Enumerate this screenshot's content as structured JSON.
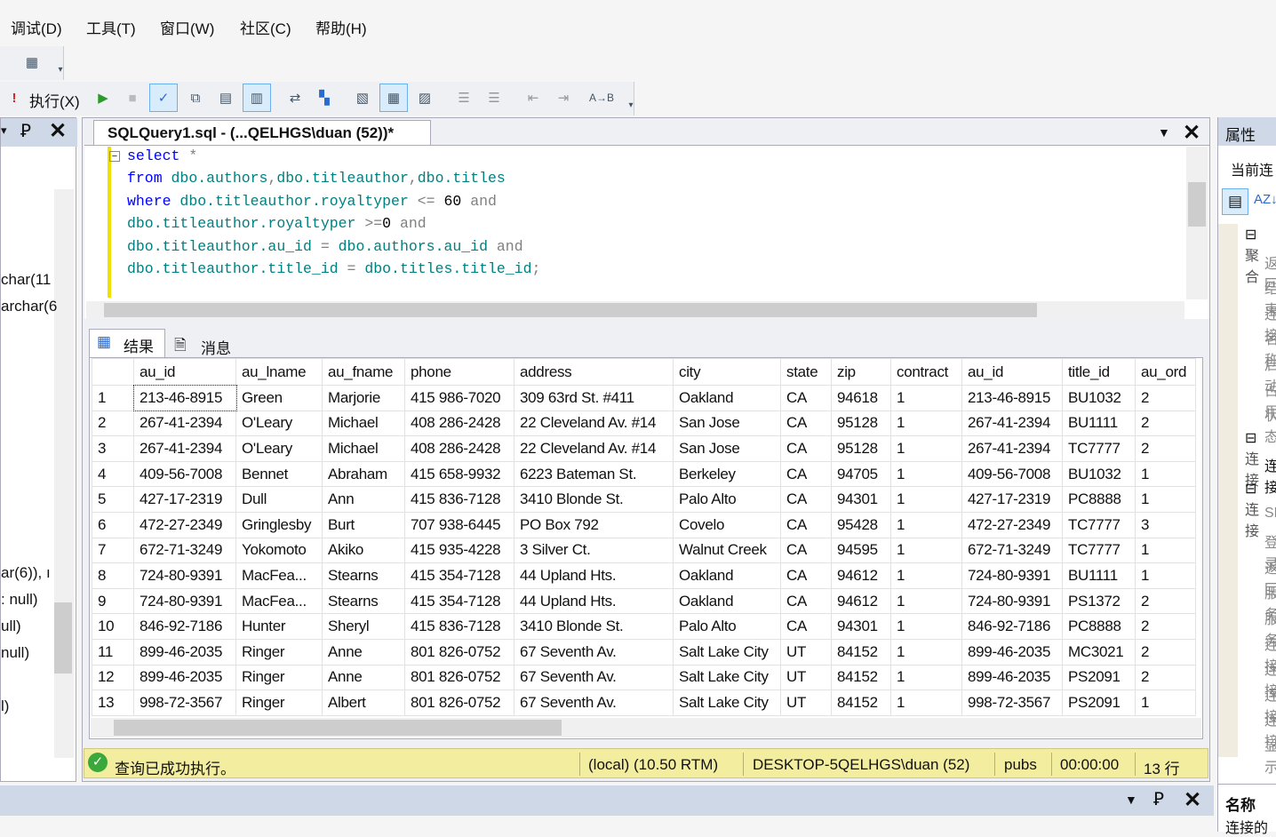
{
  "menu": [
    "调试(D)",
    "工具(T)",
    "窗口(W)",
    "社区(C)",
    "帮助(H)"
  ],
  "toolbar": {
    "execute_label": "执行(X)"
  },
  "left_panel": {
    "lines": [
      "char(11",
      "archar(6",
      "ar(6)), ı",
      ": null)",
      "ull)",
      "null)",
      "l)"
    ]
  },
  "editor": {
    "tab_title": "SQLQuery1.sql - (...QELHGS\\duan (52))*",
    "lines": [
      [
        [
          "kw",
          "select"
        ],
        [
          "op",
          " *"
        ]
      ],
      [
        [
          "kw",
          "from"
        ],
        [
          "id",
          " dbo.authors"
        ],
        [
          "op",
          ","
        ],
        [
          "id",
          "dbo.titleauthor"
        ],
        [
          "op",
          ","
        ],
        [
          "id",
          "dbo.titles"
        ]
      ],
      [
        [
          "kw",
          "where"
        ],
        [
          "id",
          " dbo.titleauthor.royaltyper"
        ],
        [
          "op",
          " <="
        ],
        [
          "nm",
          " 60"
        ],
        [
          "op",
          " and"
        ]
      ],
      [
        [
          "id",
          "dbo.titleauthor.royaltyper"
        ],
        [
          "op",
          " >="
        ],
        [
          "nm",
          "0"
        ],
        [
          "op",
          " and"
        ]
      ],
      [
        [
          "id",
          "dbo.titleauthor.au_id"
        ],
        [
          "op",
          " ="
        ],
        [
          "id",
          " dbo.authors.au_id"
        ],
        [
          "op",
          " and"
        ]
      ],
      [
        [
          "id",
          "dbo.titleauthor.title_id"
        ],
        [
          "op",
          " ="
        ],
        [
          "id",
          " dbo.titles.title_id"
        ],
        [
          "op",
          ";"
        ]
      ]
    ]
  },
  "results": {
    "tabs": [
      "结果",
      "消息"
    ],
    "columns": [
      "",
      "au_id",
      "au_lname",
      "au_fname",
      "phone",
      "address",
      "city",
      "state",
      "zip",
      "contract",
      "au_id",
      "title_id",
      "au_ord"
    ],
    "rows": [
      [
        "1",
        "213-46-8915",
        "Green",
        "Marjorie",
        "415 986-7020",
        "309 63rd St. #411",
        "Oakland",
        "CA",
        "94618",
        "1",
        "213-46-8915",
        "BU1032",
        "2"
      ],
      [
        "2",
        "267-41-2394",
        "O'Leary",
        "Michael",
        "408 286-2428",
        "22 Cleveland Av. #14",
        "San Jose",
        "CA",
        "95128",
        "1",
        "267-41-2394",
        "BU1111",
        "2"
      ],
      [
        "3",
        "267-41-2394",
        "O'Leary",
        "Michael",
        "408 286-2428",
        "22 Cleveland Av. #14",
        "San Jose",
        "CA",
        "95128",
        "1",
        "267-41-2394",
        "TC7777",
        "2"
      ],
      [
        "4",
        "409-56-7008",
        "Bennet",
        "Abraham",
        "415 658-9932",
        "6223 Bateman St.",
        "Berkeley",
        "CA",
        "94705",
        "1",
        "409-56-7008",
        "BU1032",
        "1"
      ],
      [
        "5",
        "427-17-2319",
        "Dull",
        "Ann",
        "415 836-7128",
        "3410 Blonde St.",
        "Palo Alto",
        "CA",
        "94301",
        "1",
        "427-17-2319",
        "PC8888",
        "1"
      ],
      [
        "6",
        "472-27-2349",
        "Gringlesby",
        "Burt",
        "707 938-6445",
        "PO Box 792",
        "Covelo",
        "CA",
        "95428",
        "1",
        "472-27-2349",
        "TC7777",
        "3"
      ],
      [
        "7",
        "672-71-3249",
        "Yokomoto",
        "Akiko",
        "415 935-4228",
        "3 Silver Ct.",
        "Walnut Creek",
        "CA",
        "94595",
        "1",
        "672-71-3249",
        "TC7777",
        "1"
      ],
      [
        "8",
        "724-80-9391",
        "MacFea...",
        "Stearns",
        "415 354-7128",
        "44 Upland Hts.",
        "Oakland",
        "CA",
        "94612",
        "1",
        "724-80-9391",
        "BU1111",
        "1"
      ],
      [
        "9",
        "724-80-9391",
        "MacFea...",
        "Stearns",
        "415 354-7128",
        "44 Upland Hts.",
        "Oakland",
        "CA",
        "94612",
        "1",
        "724-80-9391",
        "PS1372",
        "2"
      ],
      [
        "10",
        "846-92-7186",
        "Hunter",
        "Sheryl",
        "415 836-7128",
        "3410 Blonde St.",
        "Palo Alto",
        "CA",
        "94301",
        "1",
        "846-92-7186",
        "PC8888",
        "2"
      ],
      [
        "11",
        "899-46-2035",
        "Ringer",
        "Anne",
        "801 826-0752",
        "67 Seventh Av.",
        "Salt Lake City",
        "UT",
        "84152",
        "1",
        "899-46-2035",
        "MC3021",
        "2"
      ],
      [
        "12",
        "899-46-2035",
        "Ringer",
        "Anne",
        "801 826-0752",
        "67 Seventh Av.",
        "Salt Lake City",
        "UT",
        "84152",
        "1",
        "899-46-2035",
        "PS2091",
        "2"
      ],
      [
        "13",
        "998-72-3567",
        "Ringer",
        "Albert",
        "801 826-0752",
        "67 Seventh Av.",
        "Salt Lake City",
        "UT",
        "84152",
        "1",
        "998-72-3567",
        "PS2091",
        "1"
      ]
    ]
  },
  "status": {
    "message": "查询已成功执行。",
    "server": "(local) (10.50 RTM)",
    "user": "DESKTOP-5QELHGS\\duan (52)",
    "database": "pubs",
    "elapsed": "00:00:00",
    "rows": "13 行",
    "bg_color": "#f3eda0"
  },
  "properties": {
    "title": "属性",
    "current": "当前连",
    "groups": [
      "聚合",
      "连接",
      "连接"
    ],
    "items": [
      "返回",
      "结束",
      "连接",
      "名称",
      "启动",
      "占用",
      "状态",
      "连接",
      "SPID",
      "登录",
      "返回",
      "服务",
      "服务",
      "连接",
      "连接",
      "连接",
      "连接",
      "显示"
    ],
    "desc_title": "名称",
    "desc_text": "连接的"
  }
}
